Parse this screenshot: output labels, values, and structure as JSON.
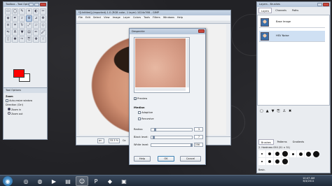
{
  "toolbox": {
    "title": "Toolbox - Tool Options",
    "options_tab": "Tool Options",
    "zoom_label": "Zoom",
    "auto_resize": "Auto-resize window",
    "direction_label": "Direction (Ctrl)",
    "zoom_in": "Zoom in",
    "zoom_out": "Zoom out",
    "fg_color": "#ff0000",
    "bg_color": "#ffffff"
  },
  "image_window": {
    "title": "*[Untitled]-(imported)-1.0 (RGB color, 1 layer) 1024x768 – GIMP",
    "menu": [
      "File",
      "Edit",
      "Select",
      "View",
      "Image",
      "Layer",
      "Colors",
      "Tools",
      "Filters",
      "Windows",
      "Help"
    ],
    "unit": "px",
    "zoom": "33.3 %",
    "status": "Co"
  },
  "dialog": {
    "title": "Despeckle",
    "preview_label": "Preview",
    "median_heading": "Median",
    "adaptive_label": "Adaptive",
    "recursive_label": "Recursive",
    "radius_label": "Radius:",
    "radius_value": "3",
    "black_label": "Black level:",
    "black_value": "7",
    "white_label": "White level:",
    "white_value": "256",
    "help_button": "Help",
    "ok_button": "OK",
    "cancel_button": "Cancel"
  },
  "layers_panel": {
    "title": "Layers - Brushes",
    "tabs": [
      "Layers",
      "Channels",
      "Paths"
    ],
    "layers": [
      {
        "name": "Base Image"
      },
      {
        "name": "HSV Noise"
      }
    ]
  },
  "brushes_panel": {
    "tabs": [
      "Brushes",
      "Patterns",
      "Gradients"
    ],
    "current_brush": "2. Hardness 050 (51 × 51)",
    "category": "Basic."
  },
  "taskbar": {
    "clock_time": "10:47 AM",
    "clock_date": "6/3/2011"
  }
}
